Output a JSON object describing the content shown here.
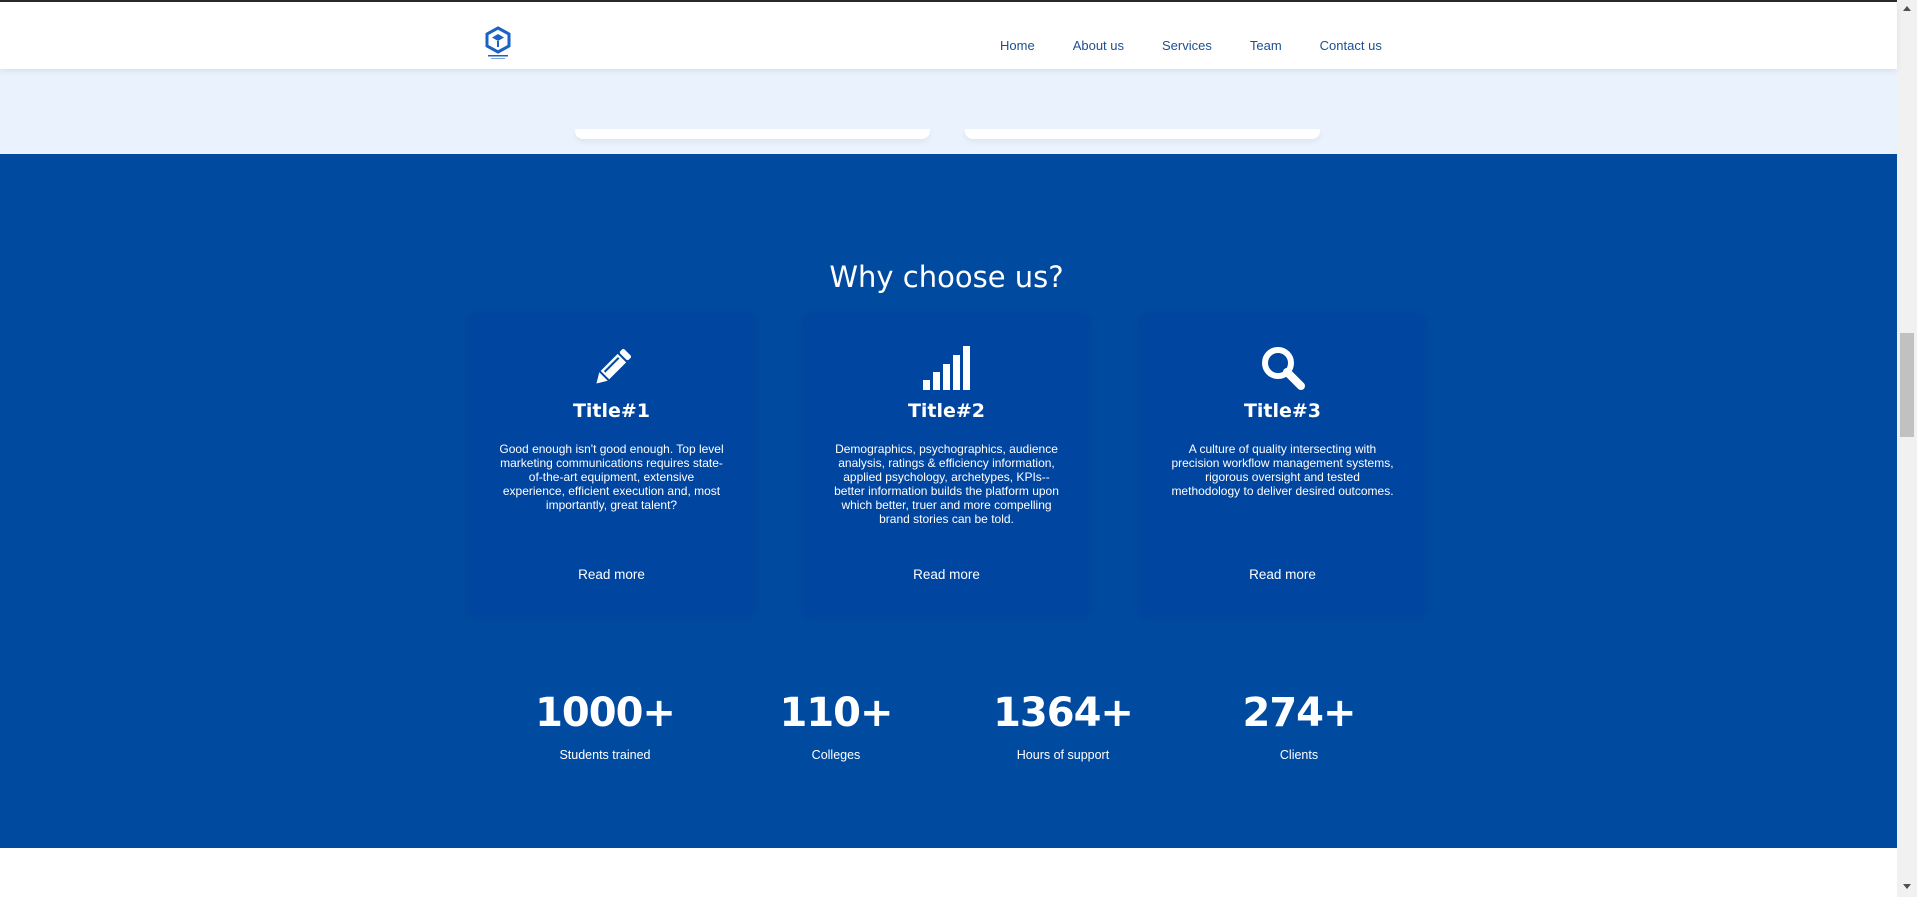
{
  "header": {
    "logo_icon": "hexagon-logo-icon",
    "nav": [
      "Home",
      "About us",
      "Services",
      "Team",
      "Contact us"
    ]
  },
  "section": {
    "title": "Why choose us?",
    "cards": [
      {
        "icon": "pencil-icon",
        "title": "Title#1",
        "text": "Good enough isn't good enough. Top level marketing communications requires state-of-the-art equipment, extensive experience, efficient execution and, most importantly, great talent?",
        "link": "Read more"
      },
      {
        "icon": "signal-bars-icon",
        "title": "Title#2",
        "text": "Demographics, psychographics, audience analysis, ratings & efficiency information, applied psychology, archetypes, KPIs-- better information builds the platform upon which better, truer and more compelling brand stories can be told.",
        "link": "Read more"
      },
      {
        "icon": "search-icon",
        "title": "Title#3",
        "text": "A culture of quality intersecting with precision workflow management systems, rigorous oversight and tested methodology to deliver desired outcomes.",
        "link": "Read more"
      }
    ],
    "stats": [
      {
        "value": "1000+",
        "label": "Students trained"
      },
      {
        "value": "110+",
        "label": "Colleges"
      },
      {
        "value": "1364+",
        "label": "Hours of support"
      },
      {
        "value": "274+",
        "label": "Clients"
      }
    ]
  },
  "colors": {
    "primary_blue": "#004aa0",
    "light_band": "#e9f2fd",
    "nav_text": "#1d4f91"
  }
}
